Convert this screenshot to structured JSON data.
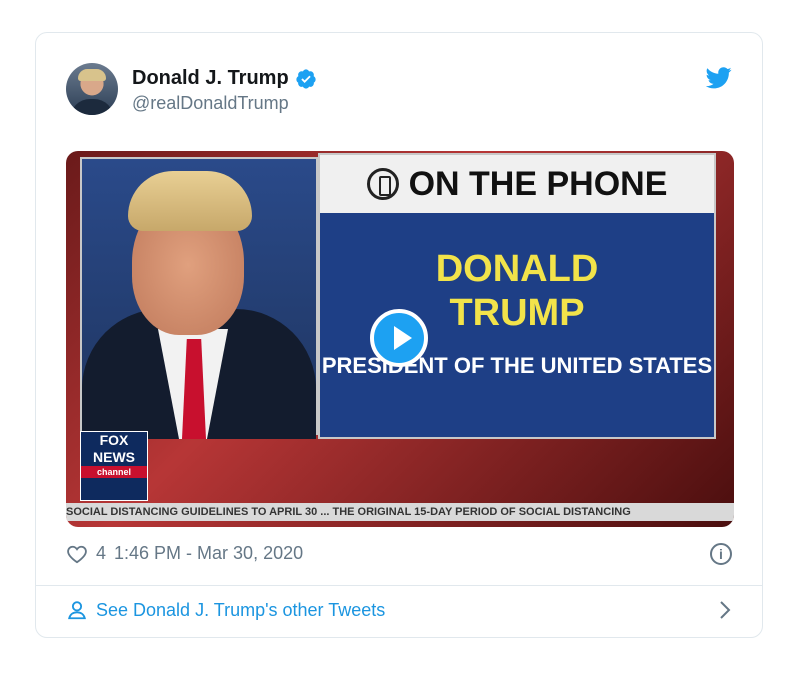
{
  "tweet": {
    "display_name": "Donald J. Trump",
    "handle": "@realDonaldTrump",
    "likes": "4",
    "timestamp": "1:46 PM - Mar 30, 2020",
    "footer_link": "See Donald J. Trump's other Tweets"
  },
  "media": {
    "phone_banner": "ON THE PHONE",
    "name_line1": "DONALD",
    "name_line2": "TRUMP",
    "title": "PRESIDENT OF THE UNITED STATES",
    "logo_line1": "FOX",
    "logo_line2": "NEWS",
    "logo_line3": "channel",
    "ticker": "SOCIAL DISTANCING GUIDELINES TO APRIL 30 ... THE ORIGINAL 15-DAY PERIOD OF SOCIAL DISTANCING"
  },
  "icons": {
    "verified": "verified-badge-icon",
    "brand": "twitter-bird-icon",
    "like": "heart-icon",
    "info": "info-icon",
    "profile": "person-icon",
    "next": "chevron-right-icon",
    "play": "play-icon"
  },
  "colors": {
    "accent": "#1da1f2",
    "link": "#1b95e0",
    "muted": "#657786",
    "text": "#14171a"
  }
}
